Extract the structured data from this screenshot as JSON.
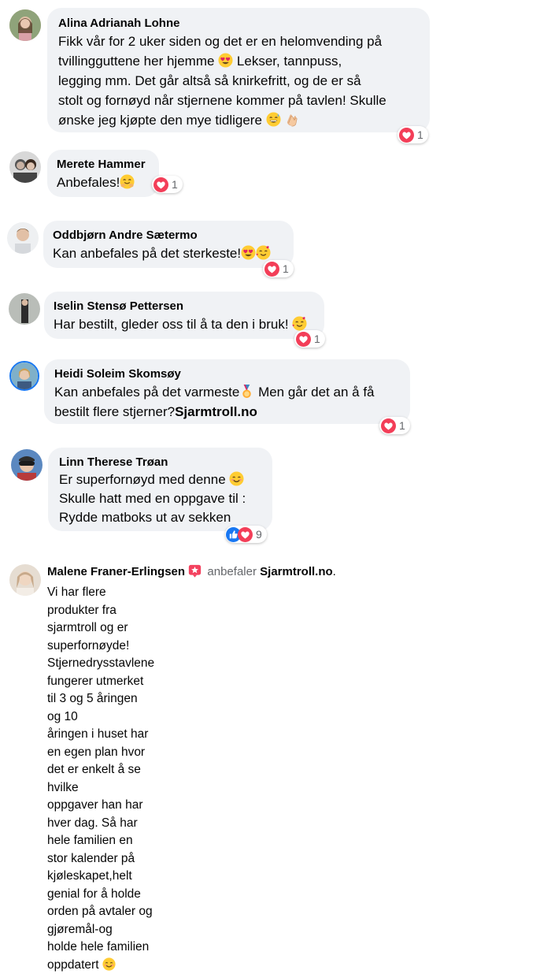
{
  "comments": [
    {
      "author": "Alina Adrianah Lohne",
      "line1": "Fikk vår for 2 uker siden og det er en helomvending på",
      "line2": "tvillingguttene her hjemme",
      "line2b": "Lekser, tannpuss,",
      "line3": "legging mm. Det går altså så knirkefritt, og de er så",
      "line4": "stolt og fornøyd når stjernene kommer på tavlen! Skulle",
      "line5": "ønske jeg kjøpte den mye tidligere",
      "reaction_count": "1"
    },
    {
      "author": "Merete Hammer",
      "line1": "Anbefales!",
      "reaction_count": "1"
    },
    {
      "author": "Oddbjørn Andre Sætermo",
      "line1": "Kan anbefales på det sterkeste!",
      "reaction_count": "1"
    },
    {
      "author": "Iselin Stensø Pettersen",
      "line1": "Har bestilt, gleder oss til å ta den i bruk!",
      "reaction_count": "1"
    },
    {
      "author": "Heidi Soleim Skomsøy",
      "line1": "Kan anbefales på det varmeste",
      "line1b": "Men går det an å få",
      "line2": "bestilt flere stjerner?",
      "line2b": "Sjarmtroll.no",
      "reaction_count": "1"
    },
    {
      "author": "Linn Therese Trøan",
      "line1": "Er superfornøyd med denne",
      "line2": "Skulle hatt med en oppgave til :",
      "line3": "Rydde matboks ut av sekken",
      "reaction_count": "9"
    }
  ],
  "review": {
    "author": "Malene Franer-Erlingsen",
    "verb": "anbefaler",
    "page": "Sjarmtroll.no",
    "period": ".",
    "line1": "Vi har flere produkter fra sjarmtroll og er superfornøyde!",
    "line2": "Stjernedrysstavlene fungerer utmerket til 3 og 5 åringen og 10",
    "line3": "åringen i huset har en egen plan hvor det er enkelt å se hvilke",
    "line4": "oppgaver han har hver dag. Så har hele familien en stor kalender på",
    "line5": "kjøleskapet,helt genial for å holde orden på avtaler og gjøremål-og",
    "line6": "holde hele familien oppdatert"
  },
  "colors": {
    "bubble": "#f0f2f5",
    "love": "#f33e58",
    "like": "#1877f2",
    "recommend": "#f3425f",
    "meta": "#65676b"
  },
  "icons": [
    "heart-eyes-emoji",
    "grin-sweat-emoji",
    "clap-emoji",
    "hug-emoji",
    "smiling-hearts-emoji",
    "medal-emoji",
    "smile-emoji",
    "love-reaction-icon",
    "like-reaction-icon",
    "recommend-star-icon"
  ]
}
